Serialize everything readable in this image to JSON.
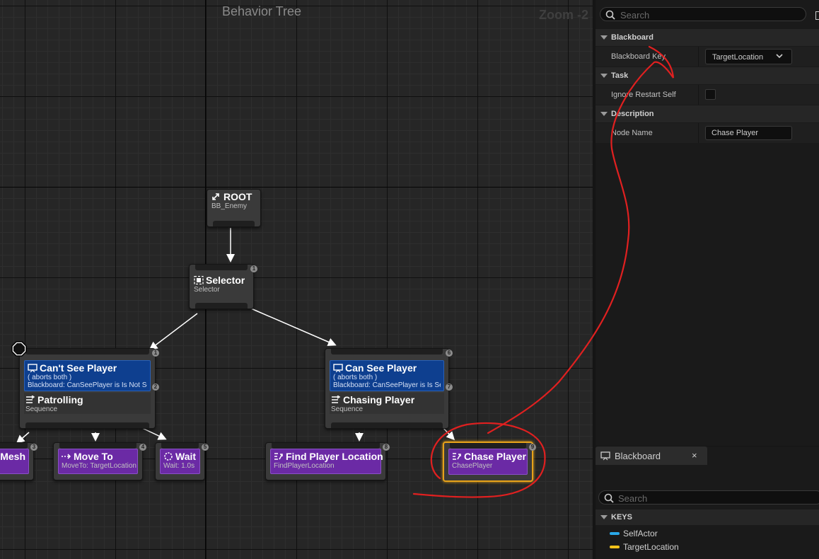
{
  "graph": {
    "title": "Behavior Tree",
    "zoom": "Zoom -2"
  },
  "nodes": {
    "root": {
      "title": "ROOT",
      "subtitle": "BB_Enemy"
    },
    "selector": {
      "title": "Selector",
      "subtitle": "Selector",
      "index": "1"
    },
    "patrolling": {
      "decorator_title": "Can't See Player",
      "decorator_aborts": "( aborts both )",
      "decorator_detail": "Blackboard: CanSeePlayer is Is Not Set",
      "decorator_index": "2",
      "title": "Patrolling",
      "subtitle": "Sequence",
      "index": "1"
    },
    "chasing": {
      "decorator_title": "Can See Player",
      "decorator_aborts": "( aborts both )",
      "decorator_detail": "Blackboard: CanSeePlayer is Is Set",
      "decorator_index": "7",
      "title": "Chasing Player",
      "subtitle": "Sequence",
      "index": "6"
    },
    "mesh": {
      "title": "Mesh",
      "index": "3"
    },
    "moveto": {
      "title": "Move To",
      "subtitle": "MoveTo: TargetLocation",
      "index": "4"
    },
    "wait": {
      "title": "Wait",
      "subtitle": "Wait: 1.0s",
      "index": "5"
    },
    "findplayer": {
      "title": "Find Player Location",
      "subtitle": "FindPlayerLocation",
      "index": "8"
    },
    "chaseplayer": {
      "title": "Chase Player",
      "subtitle": "ChasePlayer",
      "index": "9"
    }
  },
  "details": {
    "search_placeholder": "Search",
    "sections": {
      "blackboard": "Blackboard",
      "task": "Task",
      "description": "Description"
    },
    "rows": {
      "blackboard_key_label": "Blackboard Key",
      "blackboard_key_value": "TargetLocation",
      "ignore_restart_label": "Ignore Restart Self",
      "ignore_restart_checked": false,
      "node_name_label": "Node Name",
      "node_name_value": "Chase Player"
    }
  },
  "blackboard_panel": {
    "tab_label": "Blackboard",
    "close": "×",
    "search_placeholder": "Search",
    "keys_header": "KEYS",
    "keys": [
      {
        "name": "SelfActor",
        "color": "#2aa8e8"
      },
      {
        "name": "TargetLocation",
        "color": "#f2c21a"
      }
    ]
  },
  "colors": {
    "task": "#6b2aa5",
    "decorator": "#0e3f8f",
    "selection": "#e6a21a",
    "annotation": "#e02020"
  }
}
